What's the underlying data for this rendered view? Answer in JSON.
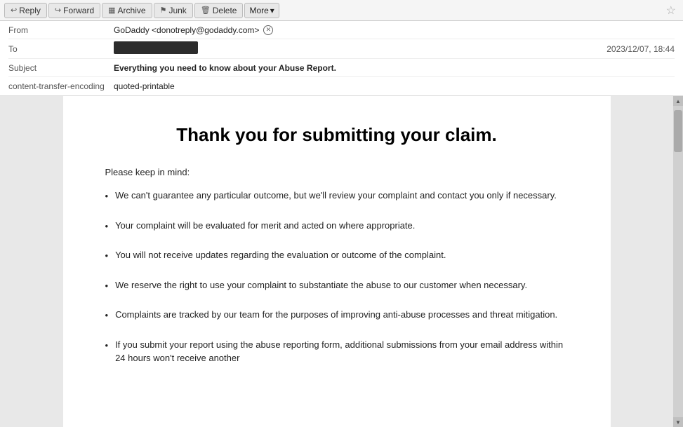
{
  "toolbar": {
    "reply_label": "Reply",
    "forward_label": "Forward",
    "archive_label": "Archive",
    "junk_label": "Junk",
    "delete_label": "Delete",
    "more_label": "More",
    "reply_icon": "↩",
    "forward_icon": "↪",
    "archive_icon": "🗄",
    "junk_icon": "🚫",
    "delete_icon": "🗑",
    "star_icon": "☆"
  },
  "headers": {
    "from_label": "From",
    "from_value": "GoDaddy <donotreply@godaddy.com>",
    "to_label": "To",
    "to_value": "",
    "subject_label": "Subject",
    "subject_value": "Everything you need to know about your Abuse Report.",
    "encoding_label": "content-transfer-encoding",
    "encoding_value": "quoted-printable",
    "date_value": "2023/12/07, 18:44"
  },
  "email_body": {
    "title": "Thank you for submitting your claim.",
    "intro": "Please keep in mind:",
    "bullet_points": [
      "We can't guarantee any particular outcome, but we'll review your complaint and contact you only if necessary.",
      "Your complaint will be evaluated for merit and acted on where appropriate.",
      "You will not receive updates regarding the evaluation or outcome of the complaint.",
      "We reserve the right to use your complaint to substantiate the abuse to our customer when necessary.",
      "Complaints are tracked by our team for the purposes of improving anti-abuse processes and threat mitigation.",
      "If you submit your report using the abuse reporting form, additional submissions from your email address within 24 hours won't receive another"
    ]
  }
}
